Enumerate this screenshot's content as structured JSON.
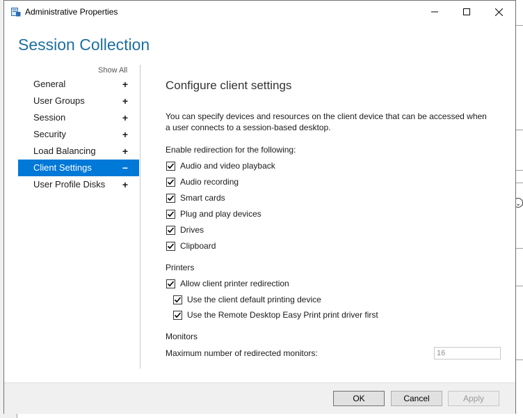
{
  "window": {
    "title": "Administrative Properties",
    "heading": "Session Collection"
  },
  "nav": {
    "show_all": "Show All",
    "items": [
      {
        "label": "General",
        "sign": "+"
      },
      {
        "label": "User Groups",
        "sign": "+"
      },
      {
        "label": "Session",
        "sign": "+"
      },
      {
        "label": "Security",
        "sign": "+"
      },
      {
        "label": "Load Balancing",
        "sign": "+"
      },
      {
        "label": "Client Settings",
        "sign": "−",
        "selected": true
      },
      {
        "label": "User Profile Disks",
        "sign": "+"
      }
    ]
  },
  "content": {
    "title": "Configure client settings",
    "description": "You can specify devices and resources on the client device that can be accessed when a user connects to a session-based desktop.",
    "redirection_label": "Enable redirection for the following:",
    "redirection_options": [
      {
        "label": "Audio and video playback",
        "checked": true
      },
      {
        "label": "Audio recording",
        "checked": true
      },
      {
        "label": "Smart cards",
        "checked": true
      },
      {
        "label": "Plug and play devices",
        "checked": true
      },
      {
        "label": "Drives",
        "checked": true
      },
      {
        "label": "Clipboard",
        "checked": true
      }
    ],
    "printers_label": "Printers",
    "printer_options": [
      {
        "label": "Allow client printer redirection",
        "checked": true
      },
      {
        "label": "Use the client default printing device",
        "checked": true
      },
      {
        "label": "Use the Remote Desktop Easy Print print driver first",
        "checked": true
      }
    ],
    "monitors_label": "Monitors",
    "max_monitors_label": "Maximum number of redirected monitors:",
    "max_monitors_value": "16"
  },
  "footer": {
    "ok": "OK",
    "cancel": "Cancel",
    "apply": "Apply"
  },
  "colors": {
    "accent": "#0078d7",
    "heading": "#1e6fa0"
  }
}
